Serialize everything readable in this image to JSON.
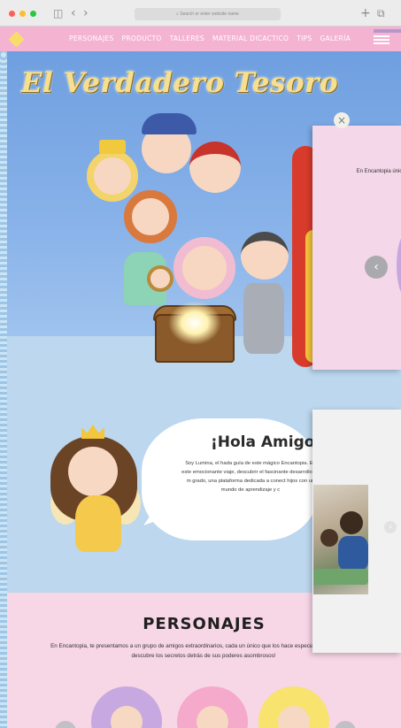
{
  "browser": {
    "url_placeholder": "Search or enter website name",
    "back_glyph": "‹",
    "forward_glyph": "›",
    "sidebar_glyph": "◫",
    "new_tab_glyph": "+",
    "tabs_glyph": "⧉"
  },
  "nav": {
    "items": [
      "PERSONAJES",
      "PRODUCTO",
      "TALLERES",
      "MATERIAL DICACTICO",
      "TIPS",
      "GALERÍA"
    ]
  },
  "hero": {
    "title": "El Verdadero Tesoro"
  },
  "greeting": {
    "heading": "¡Hola Amigos",
    "body": "Soy Lumina, el hada guía de este mágico Encantopia. En este emocionante viaje, descubrir el fascinante desarrollo de m grado, una plataforma dedicada a conect hijos con un mundo de aprendizaje y c"
  },
  "personajes": {
    "title": "PERSONAJES",
    "body": "En Encantopia, te presentamos a un grupo de amigos extraordinarios, cada un único que los hace especiales. ¡Conócelos y descubre los secretos detrás de sus poderes asombrosos!"
  },
  "overlay1": {
    "text": "En Encantopia único que",
    "close_glyph": "×",
    "prev_glyph": "‹"
  },
  "overlay2": {
    "next_glyph": "‹"
  },
  "colors": {
    "nav_pink": "#f5b3d2",
    "hero_blue": "#6f9fe0",
    "section_pink": "#f7d6e6",
    "title_gold": "#f6df8e"
  }
}
